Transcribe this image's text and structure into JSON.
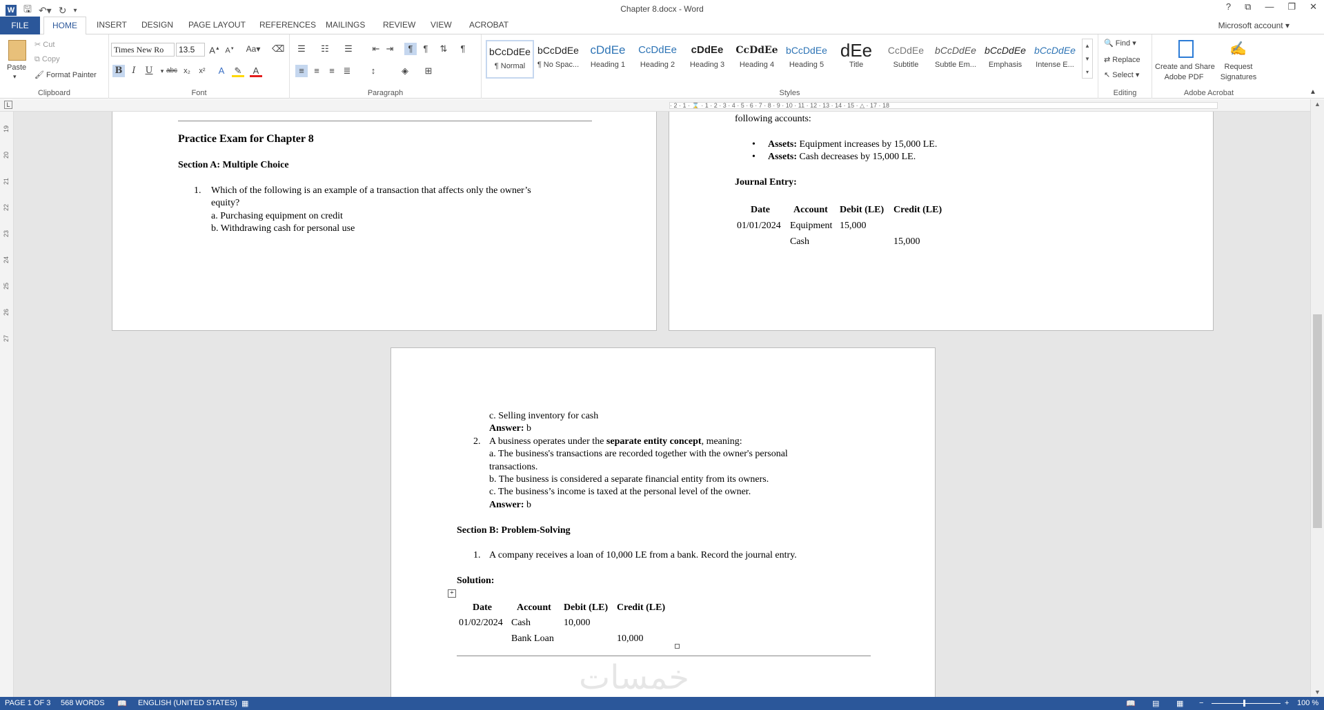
{
  "title_bar": {
    "document_title": "Chapter 8.docx - Word",
    "help": "?",
    "account": "Microsoft account"
  },
  "tabs": [
    "FILE",
    "HOME",
    "INSERT",
    "DESIGN",
    "PAGE LAYOUT",
    "REFERENCES",
    "MAILINGS",
    "REVIEW",
    "VIEW",
    "ACROBAT"
  ],
  "clipboard": {
    "paste": "Paste",
    "cut": "Cut",
    "copy": "Copy",
    "format_painter": "Format Painter",
    "label": "Clipboard"
  },
  "font": {
    "name": "Times New Ro",
    "size": "13.5",
    "label": "Font",
    "case": "Aa"
  },
  "paragraph": {
    "label": "Paragraph"
  },
  "styles": {
    "label": "Styles",
    "items": [
      {
        "preview": "bCcDdEe",
        "name": "¶ Normal"
      },
      {
        "preview": "bCcDdEe",
        "name": "¶ No Spac..."
      },
      {
        "preview": "cDdEe",
        "name": "Heading 1"
      },
      {
        "preview": "CcDdEe",
        "name": "Heading 2"
      },
      {
        "preview": "cDdEe",
        "name": "Heading 3"
      },
      {
        "preview": "CcDdEe",
        "name": "Heading 4"
      },
      {
        "preview": "bCcDdEe",
        "name": "Heading 5"
      },
      {
        "preview": "dEe",
        "name": "Title"
      },
      {
        "preview": "CcDdEe",
        "name": "Subtitle"
      },
      {
        "preview": "bCcDdEe",
        "name": "Subtle Em..."
      },
      {
        "preview": "bCcDdEe",
        "name": "Emphasis"
      },
      {
        "preview": "bCcDdEe",
        "name": "Intense E..."
      }
    ]
  },
  "editing": {
    "find": "Find",
    "replace": "Replace",
    "select": "Select",
    "label": "Editing"
  },
  "acrobat": {
    "create": "Create and Share",
    "create2": "Adobe PDF",
    "request": "Request",
    "request2": "Signatures",
    "label": "Adobe Acrobat"
  },
  "ruler_ticks": "· 2 · 1 · ⌛ · 1 · 2 · 3 · 4 · 5 · 6 · 7 · 8 · 9 · 10 · 11 · 12 · 13 · 14 · 15 · △ · 17 · 18",
  "vruler": [
    "19",
    "20",
    "21",
    "22",
    "23",
    "24",
    "25",
    "26",
    "27"
  ],
  "page1": {
    "title": "Practice Exam for Chapter 8",
    "section_a": "Section A: Multiple Choice",
    "q1_num": "1.",
    "q1_line1": "Which of the following is an example of a transaction that affects only the owner’s",
    "q1_line2": "equity?",
    "q1_a": "a. Purchasing equipment on credit",
    "q1_b": "b. Withdrawing cash for personal use"
  },
  "page2": {
    "line_top": "following accounts:",
    "bullet1_label": "Assets:",
    "bullet1_text": "Equipment increases by 15,000 LE.",
    "bullet2_label": "Assets:",
    "bullet2_text": "Cash decreases by 15,000 LE.",
    "journal_heading": "Journal Entry:",
    "th_date": "Date",
    "th_account": "Account",
    "th_debit": "Debit (LE)",
    "th_credit": "Credit (LE)",
    "r1_date": "01/01/2024",
    "r1_account": "Equipment",
    "r1_debit": "15,000",
    "r2_account": "Cash",
    "r2_credit": "15,000"
  },
  "page3": {
    "q1_c": "c. Selling inventory for cash",
    "answer_label": "Answer:",
    "answer1": "b",
    "q2_num": "2.",
    "q2_pre": "A business operates under the ",
    "q2_bold": "separate entity concept",
    "q2_post": ", meaning:",
    "q2_a1": "a. The business's transactions are recorded together with the owner's personal",
    "q2_a2": "transactions.",
    "q2_b": "b. The business is considered a separate financial entity from its owners.",
    "q2_c": "c. The business’s income is taxed at the personal level of the owner.",
    "answer2": "b",
    "section_b": "Section B: Problem-Solving",
    "p1_num": "1.",
    "p1_text": "A company receives a loan of 10,000 LE from a bank. Record the journal entry.",
    "solution": "Solution:",
    "th_date": "Date",
    "th_account": "Account",
    "th_debit": "Debit (LE)",
    "th_credit": "Credit (LE)",
    "r1_date": "01/02/2024",
    "r1_account": "Cash",
    "r1_debit": "10,000",
    "r2_account": "Bank Loan",
    "r2_credit": "10,000",
    "watermark": "خمسات"
  },
  "status": {
    "page": "PAGE 1 OF 3",
    "words": "568 WORDS",
    "language": "ENGLISH (UNITED STATES)",
    "zoom": "100 %"
  }
}
